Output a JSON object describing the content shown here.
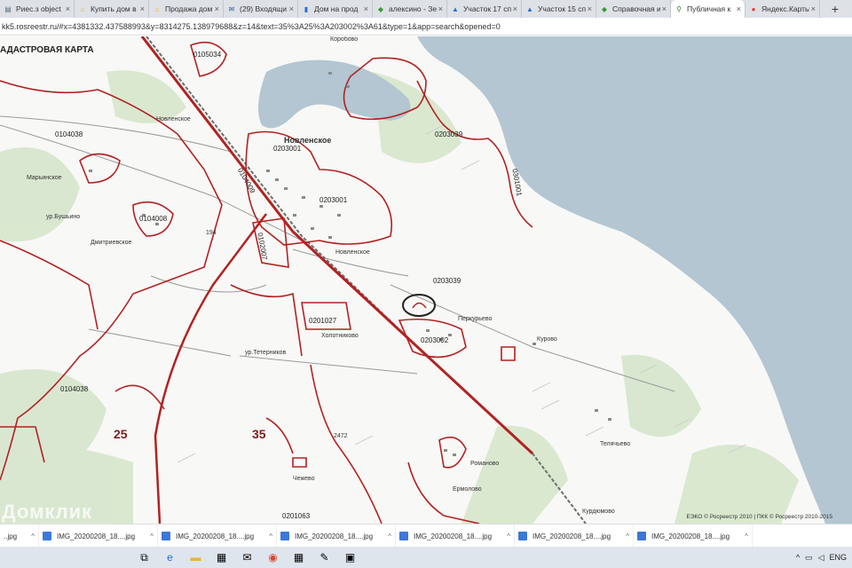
{
  "browser": {
    "tabs": [
      {
        "title": "Риес.з object",
        "icon": "document-icon",
        "active": false
      },
      {
        "title": "Купить дом в",
        "icon": "home-icon",
        "active": false
      },
      {
        "title": "Продажа дом",
        "icon": "home-icon",
        "active": false
      },
      {
        "title": "(29) Входящи",
        "icon": "mail-icon",
        "active": false
      },
      {
        "title": "Дом на прод",
        "icon": "bookmark-icon",
        "active": false
      },
      {
        "title": "алексино - Зе",
        "icon": "site-icon",
        "active": false
      },
      {
        "title": "Участок 17 сп",
        "icon": "shirt-icon",
        "active": false
      },
      {
        "title": "Участок 15 сп",
        "icon": "shirt-icon",
        "active": false
      },
      {
        "title": "Справочная и",
        "icon": "site-icon",
        "active": false
      },
      {
        "title": "Публичная к",
        "icon": "map-icon",
        "active": true
      },
      {
        "title": "Яндекс.Карты",
        "icon": "location-pin-icon",
        "active": false
      }
    ],
    "new_tab": "+",
    "tab_close": "×",
    "url": "kk5.rosreestr.ru/#x=4381332.437588993&y=8314275.138979688&z=14&text=35%3A25%3A203002%3A61&type=1&app=search&opened=0"
  },
  "map": {
    "title": "АДАСТРОВАЯ КАРТА",
    "place_labels": {
      "korobovo": "Коробово",
      "novlenskoe_big": "Новленское",
      "novlenskoe_1": "Новленское",
      "novlenskoe_2": "Новленское",
      "marino": "Марьинское",
      "bushino": "ур.Бушьино",
      "dmitrievskoe": "Дмитриевское",
      "kholotnikovo": "Холотниково",
      "teterinkovo": "ур.Тетерников",
      "perkurievo": "Перкурьево",
      "kurovo": "Курово",
      "telyachevo": "Телячьево",
      "romanovo": "Романово",
      "ermolovo": "Ермолово",
      "kurdyumovo": "Курдюмово",
      "chezhevo": "Чежево",
      "n194": "194",
      "n2472": "2472"
    },
    "cadastral_labels": {
      "c0105034": "0105034",
      "c0104038a": "0104038",
      "c0104038b": "0104038",
      "c0104008": "0104008",
      "c0104009": "0104009",
      "c0203001a": "0203001",
      "c0203001b": "0203001",
      "c0203039a": "0203039",
      "c0203039b": "0203039",
      "c0102007": "0102007",
      "c0201027": "0201027",
      "c0203002": "0203002",
      "c0301001": "0301001",
      "c0201063": "0201063"
    },
    "district_numbers": {
      "d25": "25",
      "d35": "35"
    },
    "copyright": "ЕЭКО © Росреестр 2010 | ПКК © Росреестр 2010-2015",
    "watermark": "Домклик"
  },
  "downloads": [
    {
      "name": "..jpg"
    },
    {
      "name": "IMG_20200208_18....jpg"
    },
    {
      "name": "IMG_20200208_18....jpg"
    },
    {
      "name": "IMG_20200208_18....jpg"
    },
    {
      "name": "IMG_20200208_18....jpg"
    },
    {
      "name": "IMG_20200208_18....jpg"
    },
    {
      "name": "IMG_20200208_18....jpg"
    }
  ],
  "download_caret": "^",
  "taskbar": {
    "icons": [
      "task-view-icon",
      "edge-icon",
      "file-explorer-icon",
      "store-icon",
      "mail-icon",
      "chrome-icon",
      "calculator-icon",
      "paint-icon",
      "photos-icon"
    ],
    "tray_caret": "^",
    "tray_text": "ENG"
  },
  "colors": {
    "boundary": "#b22222",
    "water": "#b3c6d2",
    "forest": "#d8e8cf",
    "railway": "#6e6e6e"
  }
}
